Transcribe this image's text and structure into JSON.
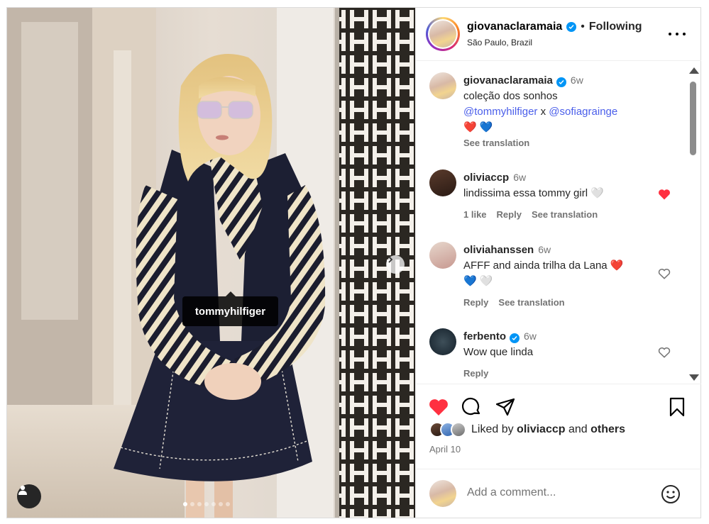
{
  "post": {
    "author": "giovanaclaramaia",
    "follow_separator": "•",
    "follow_status": "Following",
    "location": "São Paulo, Brazil",
    "photo_tag": "tommyhilfiger",
    "carousel_count": 7
  },
  "caption": {
    "username": "giovanaclaramaia",
    "time": "6w",
    "line1": "coleção dos sonhos",
    "mention1": "@tommyhilfiger",
    "joiner": "x",
    "mention2": "@sofiagrainge",
    "emojis": "❤️ 💙",
    "translate": "See translation"
  },
  "comments": [
    {
      "username": "oliviaccp",
      "time": "6w",
      "text": "lindissima essa tommy girl 🤍",
      "likes": "1 like",
      "reply": "Reply",
      "translate": "See translation",
      "liked": true
    },
    {
      "username": "oliviahanssen",
      "time": "6w",
      "text": "AFFF and ainda trilha da Lana ❤️",
      "text2": "💙 🤍",
      "reply": "Reply",
      "translate": "See translation",
      "liked": false
    },
    {
      "username": "ferbento",
      "time": "6w",
      "text": "Wow que linda",
      "reply": "Reply",
      "liked": false,
      "verified": true
    }
  ],
  "likes": {
    "prefix": "Liked by",
    "user": "oliviaccp",
    "joiner": "and",
    "others": "others"
  },
  "date": "April 10",
  "add_comment": {
    "placeholder": "Add a comment..."
  },
  "colors": {
    "like_red": "#ff3040",
    "verified_blue": "#0095f6",
    "mention_blue": "#4a5eea"
  }
}
